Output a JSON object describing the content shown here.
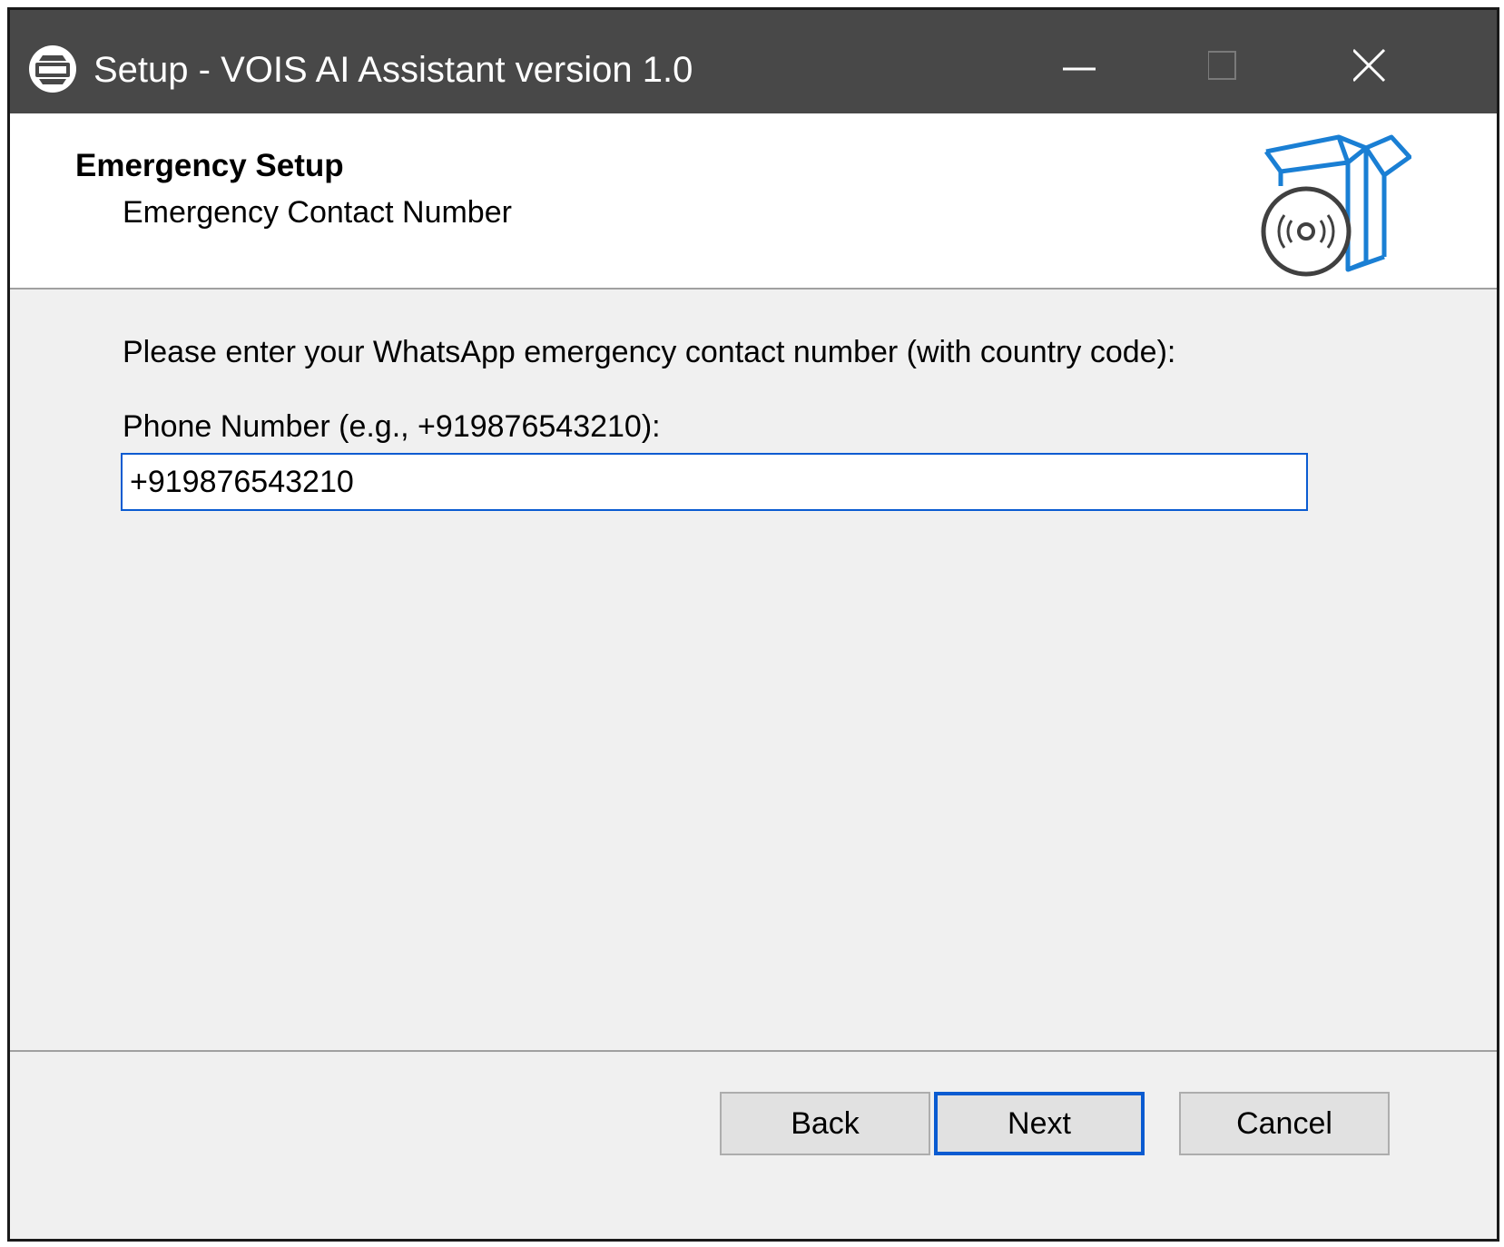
{
  "window": {
    "title": "Setup - VOIS AI Assistant version 1.0",
    "icons": {
      "app": "setup-app-icon",
      "minimize": "minimize-icon",
      "maximize": "maximize-icon",
      "close": "close-icon"
    }
  },
  "header": {
    "title": "Emergency Setup",
    "subtitle": "Emergency Contact Number",
    "image": "software-box-disc-icon"
  },
  "content": {
    "instructions": "Please enter your WhatsApp emergency contact number (with country code):",
    "phone_label": "Phone Number (e.g., +919876543210):",
    "phone_value": "+919876543210"
  },
  "buttons": {
    "back": "Back",
    "next": "Next",
    "cancel": "Cancel"
  },
  "colors": {
    "titlebar": "#484848",
    "accent": "#0a5bd1",
    "wizard_image": "#1a7fd4"
  }
}
